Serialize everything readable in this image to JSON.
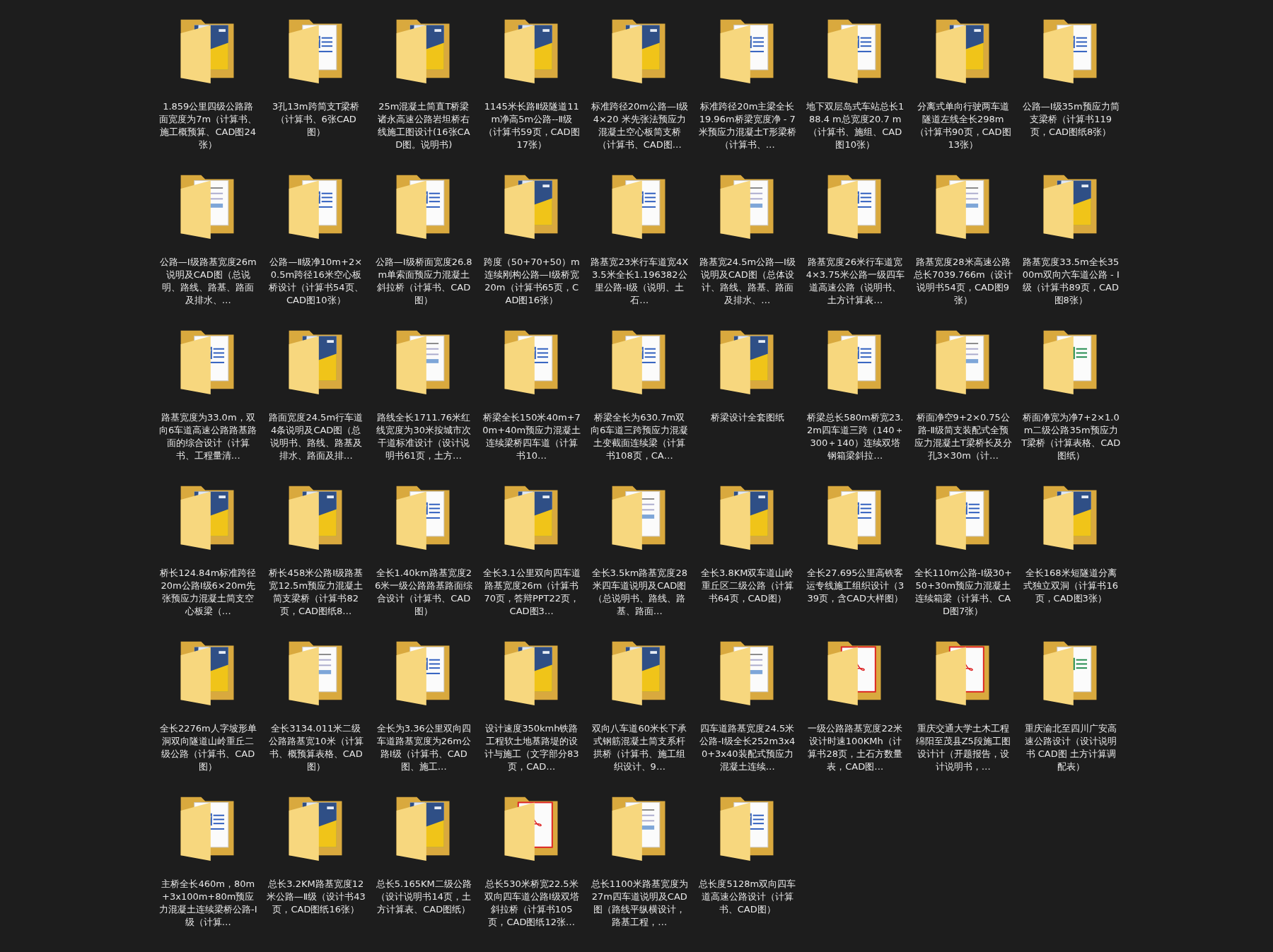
{
  "items": [
    {
      "kind": "cad",
      "name": "1.859公里四级公路路面宽度为7m（计算书、施工概预算、CAD图24张）"
    },
    {
      "kind": "word",
      "name": "3孔13m跨简支T梁桥（计算书、6张CAD图）"
    },
    {
      "kind": "cad",
      "name": "25m混凝土简直T桥梁诸永高速公路岩坦桥右线施工图设计(16张CAD图。说明书)"
    },
    {
      "kind": "cad",
      "name": "1145米长路Ⅱ级隧道11m净高5m公路--Ⅱ级（计算书59页，CAD图17张）"
    },
    {
      "kind": "cad",
      "name": "标准跨径20m公路—Ⅰ级4×20 米先张法预应力混凝土空心板简支桥（计算书、CAD图…"
    },
    {
      "kind": "word",
      "name": "标准跨径20m主梁全长19.96m桥梁宽度净 - 7米预应力混凝土T形梁桥（计算书、…"
    },
    {
      "kind": "word",
      "name": "地下双层岛式车站总长188.4 m总宽度20.7 m（计算书、施组、CAD图10张）"
    },
    {
      "kind": "cad",
      "name": "分离式单向行驶两车道隧道左线全长298m（计算书90页，CAD图13张）"
    },
    {
      "kind": "word",
      "name": "公路—Ⅰ级35m预应力简支梁桥（计算书119页，CAD图纸8张）"
    },
    {
      "kind": "paper",
      "name": "公路—Ⅰ级路基宽度26m说明及CAD图（总说明、路线、路基、路面及排水、…"
    },
    {
      "kind": "word",
      "name": "公路—Ⅱ级净10m+2×0.5m跨径16米空心板桥设计（计算书54页、CAD图10张）"
    },
    {
      "kind": "word",
      "name": "公路—Ⅰ级桥面宽度26.8m单索面预应力混凝土斜拉桥（计算书、CAD图）"
    },
    {
      "kind": "cad",
      "name": "跨度（50+70+50）m连续刚构公路—Ⅰ级桥宽20m（计算书65页，CAD图16张）"
    },
    {
      "kind": "word",
      "name": "路基宽23米行车道宽4X3.5米全长1.196382公里公路-Ⅰ级（说明、土石…"
    },
    {
      "kind": "paper",
      "name": "路基宽24.5m公路—Ⅰ级说明及CAD图（总体设计、路线、路基、路面及排水、…"
    },
    {
      "kind": "word",
      "name": "路基宽度26米行车道宽4×3.75米公路一级四车道高速公路（说明书、土方计算表…"
    },
    {
      "kind": "paper",
      "name": "路基宽度28米高速公路总长7039.766m（设计说明书54页，CAD图9张）"
    },
    {
      "kind": "cad",
      "name": "路基宽度33.5m全长3500m双向六车道公路 - Ⅰ级（计算书89页，CAD图8张）"
    },
    {
      "kind": "word",
      "name": "路基宽度为33.0m，双向6车道高速公路路基路面的综合设计（计算书、工程量清…"
    },
    {
      "kind": "cad",
      "name": "路面宽度24.5m行车道4条说明及CAD图（总说明书、路线、路基及排水、路面及排…"
    },
    {
      "kind": "paper",
      "name": "路线全长1711.76米红线宽度为30米按城市次干道标准设计（设计说明书61页，土方…"
    },
    {
      "kind": "word",
      "name": "桥梁全长150米40m+70m+40m预应力混凝土连续梁桥四车道（计算书10…"
    },
    {
      "kind": "word",
      "name": "桥梁全长为630.7m双向6车道三跨预应力混凝土变截面连续梁（计算书108页，CA…"
    },
    {
      "kind": "cad",
      "name": "桥梁设计全套图纸"
    },
    {
      "kind": "word",
      "name": "桥梁总长580m桥宽23.2m四车道三跨（140＋300＋140）连续双塔钢箱梁斜拉…"
    },
    {
      "kind": "paper",
      "name": "桥面净空9+2×0.75公路-Ⅱ级简支装配式全预应力混凝土T梁桥长及分孔3×30m（计…"
    },
    {
      "kind": "excel",
      "name": "桥面净宽为净7+2×1.0m二级公路35m预应力T梁桥（计算表格、CAD图纸）"
    },
    {
      "kind": "cad",
      "name": "桥长124.84m标准跨径20m公路Ⅰ级6×20m先张预应力混凝土简支空心板梁（…"
    },
    {
      "kind": "cad",
      "name": "桥长458米公路Ⅰ级路基宽12.5m预应力混凝土简支梁桥（计算书82页，CAD图纸8…"
    },
    {
      "kind": "word",
      "name": "全长1.40km路基宽度26米一级公路路基路面综合设计（计算书、CAD图）"
    },
    {
      "kind": "cad",
      "name": "全长3.1公里双向四车道路基宽度26m（计算书70页，答辩PPT22页，CAD图3…"
    },
    {
      "kind": "paper",
      "name": "全长3.5km路基宽度28米四车道说明及CAD图（总说明书、路线、路基、路面…"
    },
    {
      "kind": "cad",
      "name": "全长3.8KM双车道山岭重丘区二级公路（计算书64页，CAD图）"
    },
    {
      "kind": "word",
      "name": "全长27.695公里高铁客运专线施工组织设计（339页，含CAD大样图）"
    },
    {
      "kind": "word",
      "name": "全长110m公路-Ⅰ级30+50+30m预应力混凝土连续箱梁（计算书、CAD图7张）"
    },
    {
      "kind": "cad",
      "name": "全长168米短隧道分离式独立双洞（计算书16页，CAD图3张）"
    },
    {
      "kind": "cad",
      "name": "全长2276m人字坡形单洞双向隧道山岭重丘二级公路（计算书、CAD图）"
    },
    {
      "kind": "paper",
      "name": "全长3134.011米二级公路路基宽10米（计算书、概预算表格、CAD图）"
    },
    {
      "kind": "word",
      "name": "全长为3.36公里双向四车道路基宽度为26m公路Ⅰ级（计算书、CAD图、施工…"
    },
    {
      "kind": "cad",
      "name": "设计速度350kmh铁路工程软土地基路堤的设计与施工（文字部分83页，CAD…"
    },
    {
      "kind": "cad",
      "name": "双向八车道60米长下承式钢筋混凝土简支系杆拱桥（计算书、施工组织设计、9…"
    },
    {
      "kind": "paper",
      "name": "四车道路基宽度24.5米公路-Ⅰ级全长252m3x40+3x40装配式预应力混凝土连续…"
    },
    {
      "kind": "pdf",
      "name": "一级公路路基宽度22米设计时速100KMh（计算书28页，土石方数量表，CAD图…"
    },
    {
      "kind": "pdf",
      "name": "重庆交通大学土木工程绵阳至茂县Z5段施工图设计计（开题报告，设计说明书，…"
    },
    {
      "kind": "excel",
      "name": "重庆渝北至四川广安高速公路设计（设计说明书 CAD图 土方计算调配表）"
    },
    {
      "kind": "word",
      "name": "主桥全长460m，80m+3x100m+80m预应力混凝土连续梁桥公路-Ⅰ级（计算…"
    },
    {
      "kind": "cad",
      "name": "总长3.2KM路基宽度12米公路—Ⅱ级（设计书43页，CAD图纸16张）"
    },
    {
      "kind": "cad",
      "name": "总长5.165KM二级公路（设计说明书14页，土方计算表、CAD图纸）"
    },
    {
      "kind": "pdf",
      "name": "总长530米桥宽22.5米双向四车道公路Ⅰ级双塔斜拉桥（计算书105页，CAD图纸12张…"
    },
    {
      "kind": "paper",
      "name": "总长1100米路基宽度为27m四车道说明及CAD图（路线平纵横设计，路基工程，…"
    },
    {
      "kind": "word",
      "name": "总长度5128m双向四车道高速公路设计（计算书、CAD图）"
    }
  ]
}
